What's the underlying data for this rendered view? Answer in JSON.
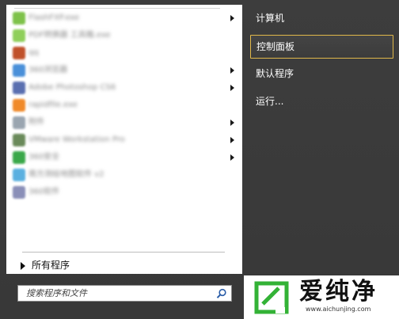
{
  "right_pane": {
    "items": [
      {
        "label": "计算机"
      },
      {
        "label": "控制面板"
      },
      {
        "label": "默认程序"
      },
      {
        "label": "运行..."
      }
    ]
  },
  "all_programs": {
    "label": "所有程序"
  },
  "search": {
    "placeholder": "搜索程序和文件"
  },
  "logo": {
    "text": "爱纯净",
    "url": "www.aichunjing.com"
  },
  "programs": [
    {
      "label": "FlashFXP.exe",
      "icon": "app-icon",
      "color": "#7ec24a",
      "submenu": true
    },
    {
      "label": "PDF转换器 工具箱.exe",
      "icon": "app-icon",
      "color": "#8fcf5a",
      "submenu": false
    },
    {
      "label": "qq",
      "icon": "app-icon",
      "color": "#c0512a",
      "submenu": false
    },
    {
      "label": "360浏览器",
      "icon": "app-icon",
      "color": "#4a90d9",
      "submenu": true
    },
    {
      "label": "Adobe Photoshop CS6",
      "icon": "app-icon",
      "color": "#5a6fb0",
      "submenu": true
    },
    {
      "label": "rapidfile.exe",
      "icon": "app-icon",
      "color": "#f08a2a",
      "submenu": false
    },
    {
      "label": "附件",
      "icon": "app-icon",
      "color": "#9aa5b0",
      "submenu": true
    },
    {
      "label": "VMware Workstation Pro",
      "icon": "app-icon",
      "color": "#6a8a5a",
      "submenu": true
    },
    {
      "label": "360安全",
      "icon": "app-icon",
      "color": "#3aa84a",
      "submenu": true
    },
    {
      "label": "南方测绘地图软件 v2",
      "icon": "app-icon",
      "color": "#5ab0e0",
      "submenu": false
    },
    {
      "label": "360软件",
      "icon": "app-icon",
      "color": "#8a8fb8",
      "submenu": false
    }
  ],
  "colors": {
    "highlight_border": "#e0b84a",
    "logo_green": "#33b236"
  }
}
